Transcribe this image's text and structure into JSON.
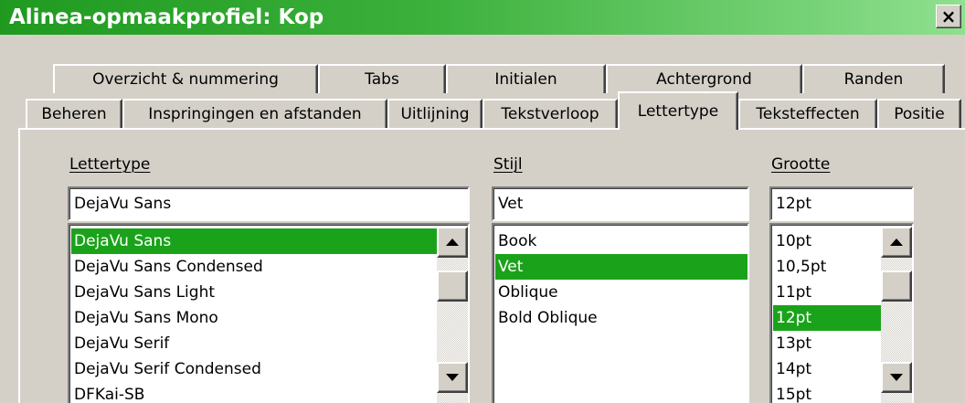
{
  "window": {
    "title": "Alinea-opmaakprofiel: Kop",
    "close_label": "×"
  },
  "tabs": {
    "row_back": [
      {
        "label": "Overzicht & nummering"
      },
      {
        "label": "Tabs"
      },
      {
        "label": "Initialen"
      },
      {
        "label": "Achtergrond"
      },
      {
        "label": "Randen"
      }
    ],
    "row_front": [
      {
        "label": "Beheren"
      },
      {
        "label": "Inspringingen en afstanden"
      },
      {
        "label": "Uitlijning"
      },
      {
        "label": "Tekstverloop"
      },
      {
        "label": "Lettertype",
        "active": true
      },
      {
        "label": "Teksteffecten"
      },
      {
        "label": "Positie"
      }
    ]
  },
  "font_tab": {
    "family": {
      "label": "Lettertype",
      "value": "DejaVu Sans",
      "items": [
        "DejaVu Sans",
        "DejaVu Sans Condensed",
        "DejaVu Sans Light",
        "DejaVu Sans Mono",
        "DejaVu Serif",
        "DejaVu Serif Condensed",
        "DFKai-SB"
      ],
      "selected": "DejaVu Sans"
    },
    "style": {
      "label": "Stijl",
      "value": "Vet",
      "items": [
        "Book",
        "Vet",
        "Oblique",
        "Bold Oblique"
      ],
      "selected": "Vet"
    },
    "size": {
      "label": "Grootte",
      "value": "12pt",
      "items": [
        "10pt",
        "10,5pt",
        "11pt",
        "12pt",
        "13pt",
        "14pt",
        "15pt"
      ],
      "selected": "12pt"
    }
  },
  "icons": {
    "close": "close-icon",
    "scroll_up": "arrow-up-icon",
    "scroll_down": "arrow-down-icon"
  },
  "colors": {
    "title_start": "#1f9a1f",
    "title_end": "#8fe08f",
    "selection": "#1aa31a",
    "dialog_bg": "#d4d0c8"
  }
}
